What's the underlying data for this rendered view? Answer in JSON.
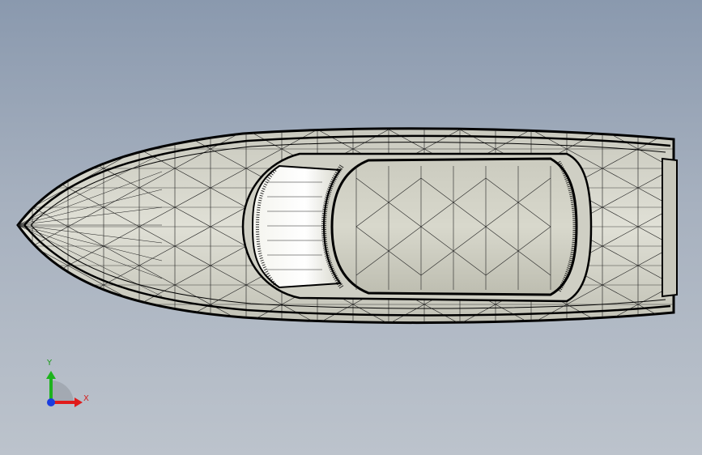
{
  "viewport": {
    "background_top": "#8a99ae",
    "background_bottom": "#bcc3cc"
  },
  "model": {
    "type": "boat-hull-wireframe",
    "view": "top",
    "display_style": "shaded-with-edges",
    "face_color": "#d9d9cf",
    "edge_color": "#000000"
  },
  "triad": {
    "x_label": "X",
    "y_label": "Y",
    "x_color": "#e01b1b",
    "y_color": "#1db31d",
    "z_color": "#1a3de0"
  }
}
